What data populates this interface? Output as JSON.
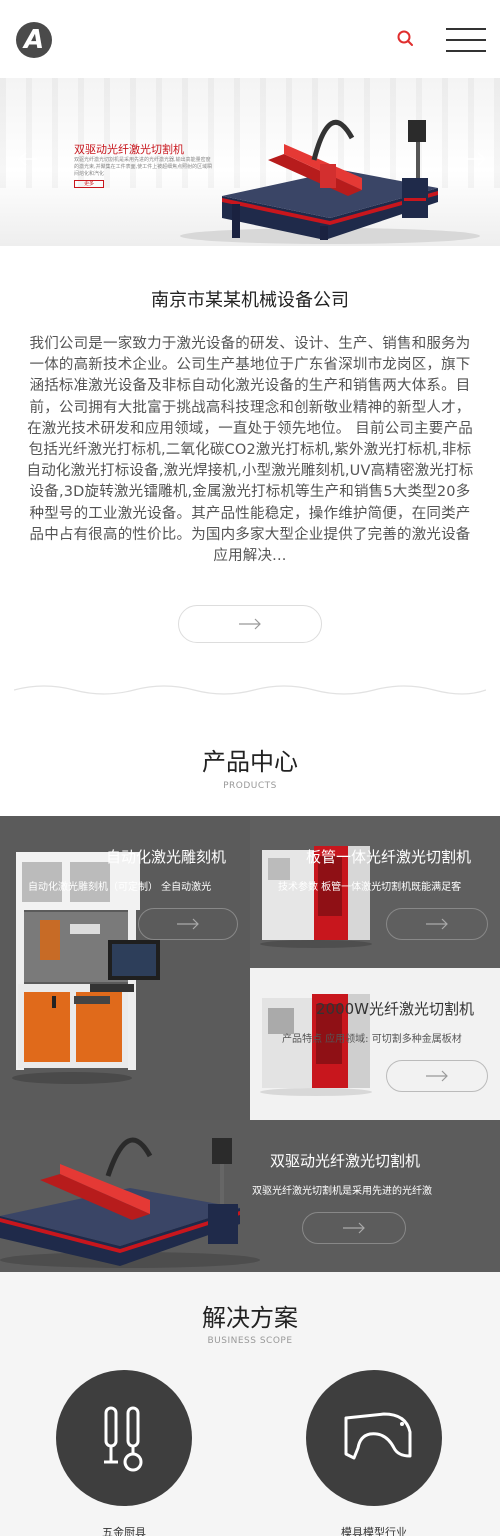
{
  "header": {
    "logo_letter": "A",
    "search_icon": "search-icon",
    "menu_icon": "hamburger-menu-icon",
    "accent_color": "#e02e2e"
  },
  "banner": {
    "title": "双驱动光纤激光切割机",
    "description": "双驱光纤激光切割机是采用先进的光纤激光器,输出高能量密度的激光束,并聚集在工件表面,使工件上被超细焦点照射的区域瞬间熔化和汽化",
    "button_label": "更多"
  },
  "about": {
    "title": "南京市某某机械设备公司",
    "text": "我们公司是一家致力于激光设备的研发、设计、生产、销售和服务为一体的高新技术企业。公司生产基地位于广东省深圳市龙岗区，旗下涵括标准激光设备及非标自动化激光设备的生产和销售两大体系。目前，公司拥有大批富于挑战高科技理念和创新敬业精神的新型人才，在激光技术研发和应用领域，一直处于领先地位。 目前公司主要产品包括光纤激光打标机,二氧化碳CO2激光打标机,紫外激光打标机,非标自动化激光打标设备,激光焊接机,小型激光雕刻机,UV高精密激光打标设备,3D旋转激光镭雕机,金属激光打标机等生产和销售5大类型20多种型号的工业激光设备。其产品性能稳定，操作维护简便，在同类产品中占有很高的性价比。为国内多家大型企业提供了完善的激光设备应用解决..."
  },
  "products": {
    "title": "产品中心",
    "subtitle": "PRODUCTS",
    "items": [
      {
        "title": "自动化激光雕刻机",
        "desc": "自动化激光雕刻机（可定制） 全自动激光"
      },
      {
        "title": "板管一体光纤激光切割机",
        "desc": "技术参数 板管一体激光切割机既能满足客"
      },
      {
        "title": "2000W光纤激光切割机",
        "desc": "产品特点 应用领域: 可切割多种金属板材"
      },
      {
        "title": "双驱动光纤激光切割机",
        "desc": "双驱光纤激光切割机是采用先进的光纤激"
      }
    ]
  },
  "solutions": {
    "title": "解决方案",
    "subtitle": "BUSINESS SCOPE",
    "items": [
      {
        "label": "五金厨具",
        "icon": "kitchen-utensils-icon"
      },
      {
        "label": "模具模型行业",
        "icon": "mold-model-icon"
      }
    ]
  }
}
